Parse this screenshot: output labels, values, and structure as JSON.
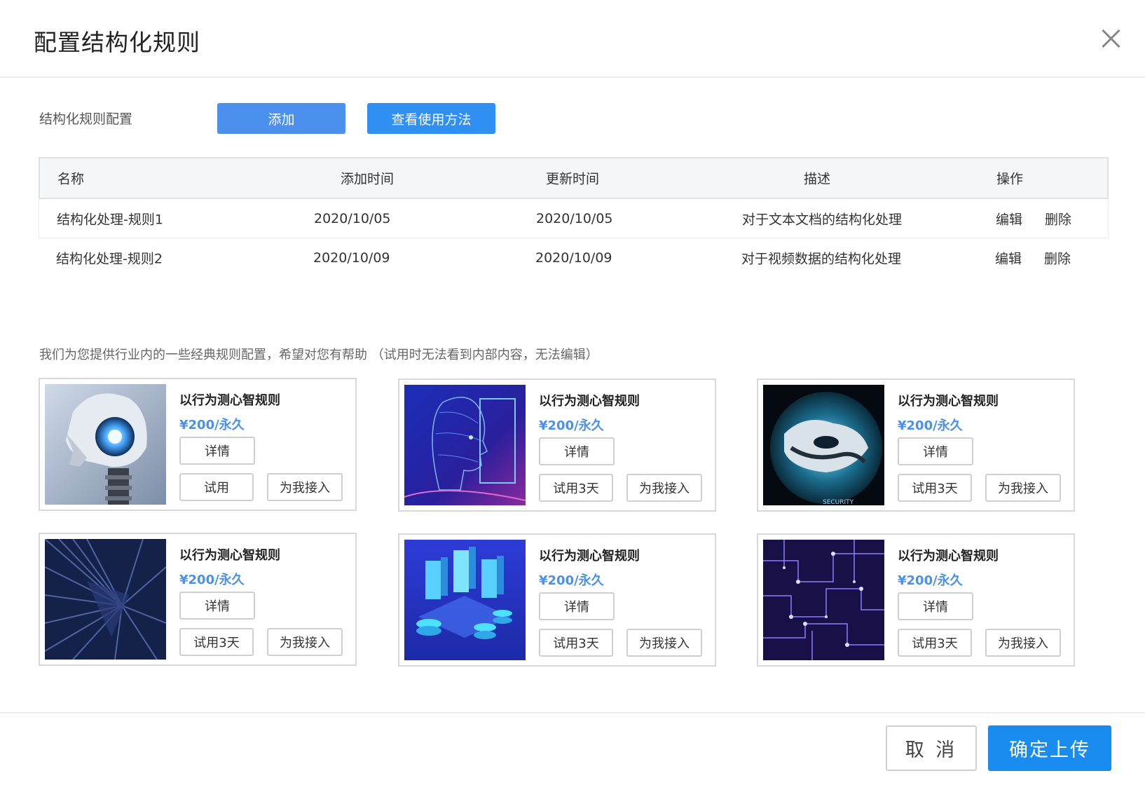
{
  "dialog": {
    "title": "配置结构化规则"
  },
  "toolbar": {
    "label": "结构化规则配置",
    "add_label": "添加",
    "howto_label": "查看使用方法"
  },
  "table": {
    "headers": [
      "名称",
      "添加时间",
      "更新时间",
      "描述",
      "操作"
    ],
    "rows": [
      {
        "name": "结构化处理-规则1",
        "added": "2020/10/05",
        "updated": "2020/10/05",
        "desc": "对于文本文档的结构化处理",
        "edit": "编辑",
        "delete": "删除"
      },
      {
        "name": "结构化处理-规则2",
        "added": "2020/10/09",
        "updated": "2020/10/09",
        "desc": "对于视频数据的结构化处理",
        "edit": "编辑",
        "delete": "删除"
      }
    ]
  },
  "hint": "我们为您提供行业内的一些经典规则配置，希望对您有帮助 （试用时无法看到内部内容，无法编辑）",
  "cards": [
    {
      "name": "以行为测心智规则",
      "price": "¥200/永久",
      "detail": "详情",
      "trial": "试用",
      "access": "为我接入",
      "image": "robot-head"
    },
    {
      "name": "以行为测心智规则",
      "price": "¥200/永久",
      "detail": "详情",
      "trial": "试用3天",
      "access": "为我接入",
      "image": "face-scan"
    },
    {
      "name": "以行为测心智规则",
      "price": "¥200/永久",
      "detail": "详情",
      "trial": "试用3天",
      "access": "为我接入",
      "image": "security-globe"
    },
    {
      "name": "以行为测心智规则",
      "price": "¥200/永久",
      "detail": "详情",
      "trial": "试用3天",
      "access": "为我接入",
      "image": "abstract-rays"
    },
    {
      "name": "以行为测心智规则",
      "price": "¥200/永久",
      "detail": "详情",
      "trial": "试用3天",
      "access": "为我接入",
      "image": "isometric-servers"
    },
    {
      "name": "以行为测心智规则",
      "price": "¥200/永久",
      "detail": "详情",
      "trial": "试用3天",
      "access": "为我接入",
      "image": "circuit-board"
    }
  ],
  "thumb_text": {
    "security": "SECURITY"
  },
  "footer": {
    "cancel_label": "取 消",
    "ok_label": "确定上传"
  },
  "colors": {
    "primary": "#4a90ec",
    "ok": "#1a8cf0",
    "price": "#4a90ec"
  }
}
